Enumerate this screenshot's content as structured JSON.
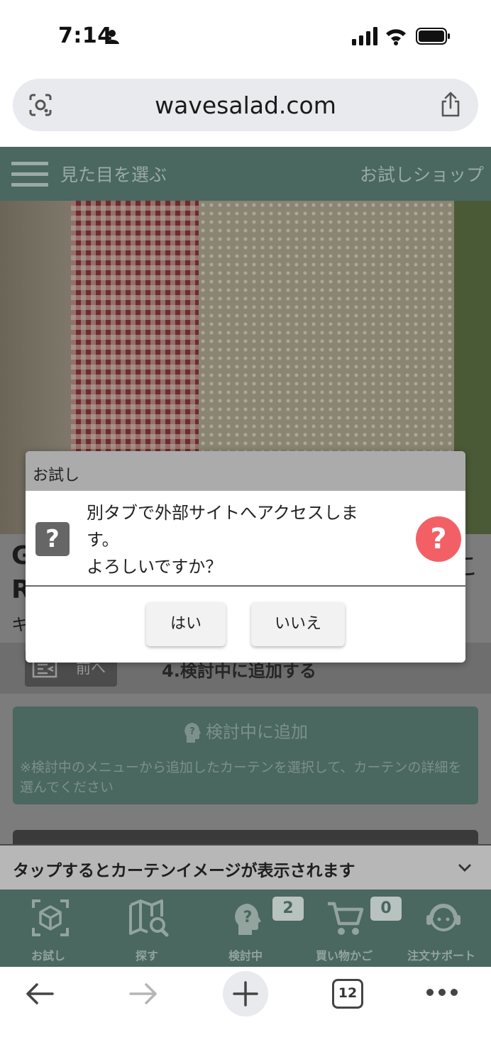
{
  "status_bar": {
    "time": "7:14"
  },
  "browser": {
    "url": "wavesalad.com",
    "tab_count": "12"
  },
  "site_header": {
    "title": "見た目を選ぶ",
    "right_label": "お試しショップ"
  },
  "page": {
    "product_title_line1": "G",
    "product_title_line2": "R",
    "product_title_tail": "こ",
    "product_subtitle": "キ",
    "prev_button": "前へ",
    "step_title": "4.検討中に追加する",
    "add_card_title": "検討中に追加",
    "add_card_desc": "※検討中のメニューから追加したカーテンを選択して、カーテンの詳細を選んでください"
  },
  "tap_banner": {
    "text": "タップするとカーテンイメージが表示されます"
  },
  "app_nav": {
    "items": [
      {
        "label": "お試し",
        "icon": "cube-scan-icon"
      },
      {
        "label": "探す",
        "icon": "map-search-icon"
      },
      {
        "label": "検討中",
        "icon": "head-question-icon",
        "badge": "2"
      },
      {
        "label": "買い物かご",
        "icon": "cart-icon",
        "badge": "0"
      },
      {
        "label": "注文サポート",
        "icon": "support-agent-icon"
      }
    ]
  },
  "dialog": {
    "title": "お試し",
    "message_lines": [
      "別タブで外部サイトへアクセスしま",
      "す。",
      "よろしいですか？"
    ],
    "question_mark": "?",
    "yes_label": "はい",
    "no_label": "いいえ"
  },
  "colors": {
    "header_green": "#4a6760",
    "help_red": "#f26066",
    "dialog_header_gray": "#ababab"
  }
}
